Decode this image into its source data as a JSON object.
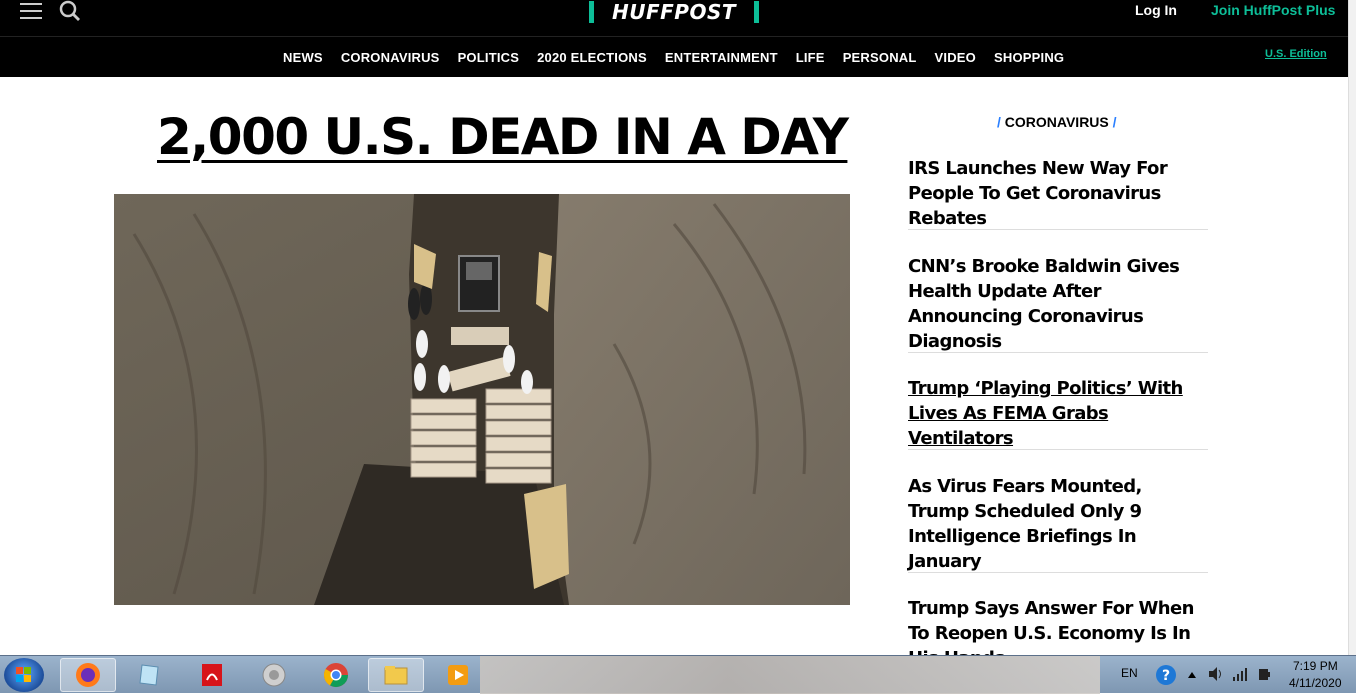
{
  "header": {
    "logo_text": "HUFFPOST",
    "login_label": "Log In",
    "join_label": "Join HuffPost Plus",
    "edition_label": "U.S. Edition"
  },
  "nav": {
    "items": [
      {
        "label": "NEWS"
      },
      {
        "label": "CORONAVIRUS"
      },
      {
        "label": "POLITICS"
      },
      {
        "label": "2020 ELECTIONS"
      },
      {
        "label": "ENTERTAINMENT"
      },
      {
        "label": "LIFE"
      },
      {
        "label": "PERSONAL"
      },
      {
        "label": "VIDEO"
      },
      {
        "label": "SHOPPING"
      }
    ]
  },
  "main": {
    "headline": "2,000 U.S. DEAD IN A DAY"
  },
  "sidebar": {
    "section_label": "CORONAVIRUS",
    "stories": [
      {
        "title": "IRS Launches New Way For People To Get Coronavirus Rebates"
      },
      {
        "title": "CNN’s Brooke Baldwin Gives Health Update After Announcing Coronavirus Diagnosis"
      },
      {
        "title": "Trump ‘Playing Politics’ With Lives As FEMA Grabs Ventilators"
      },
      {
        "title": "As Virus Fears Mounted, Trump Scheduled Only 9 Intelligence Briefings In January"
      },
      {
        "title": "Trump Says Answer For When To Reopen U.S. Economy Is In His Hands"
      }
    ]
  },
  "taskbar": {
    "apps": [
      "firefox-icon",
      "notepad-icon",
      "acrobat-icon",
      "speaker-app-icon",
      "chrome-icon",
      "explorer-icon",
      "media-player-icon"
    ],
    "language": "EN",
    "time": "7:19 PM",
    "date": "4/11/2020"
  },
  "colors": {
    "brand_green": "#0dbe98",
    "section_slash": "#2a7fff"
  }
}
